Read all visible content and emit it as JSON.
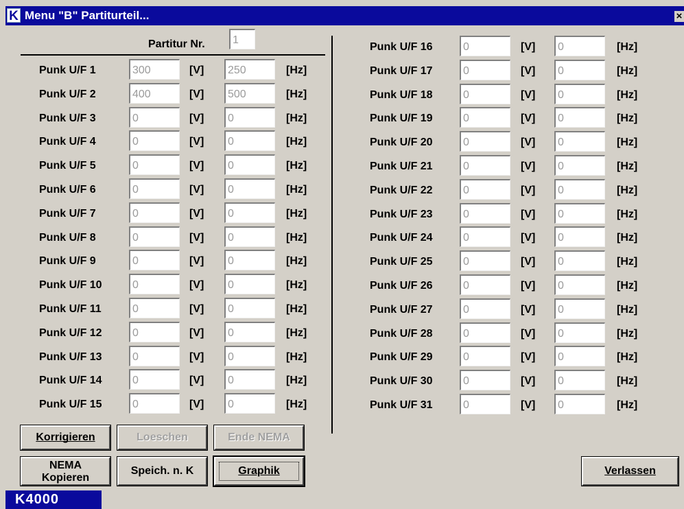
{
  "window": {
    "title": "Menu \"B\" Partiturteil...",
    "icon_letter": "K",
    "close_glyph": "×"
  },
  "partitur": {
    "label": "Partitur Nr.",
    "value": "1"
  },
  "units": {
    "volt": "[V]",
    "hertz": "[Hz]"
  },
  "left_rows": [
    {
      "label": "Punk U/F  1",
      "v": "300",
      "f": "250"
    },
    {
      "label": "Punk U/F  2",
      "v": "400",
      "f": "500"
    },
    {
      "label": "Punk U/F  3",
      "v": "0",
      "f": "0"
    },
    {
      "label": "Punk U/F  4",
      "v": "0",
      "f": "0"
    },
    {
      "label": "Punk U/F  5",
      "v": "0",
      "f": "0"
    },
    {
      "label": "Punk U/F  6",
      "v": "0",
      "f": "0"
    },
    {
      "label": "Punk U/F  7",
      "v": "0",
      "f": "0"
    },
    {
      "label": "Punk U/F  8",
      "v": "0",
      "f": "0"
    },
    {
      "label": "Punk U/F  9",
      "v": "0",
      "f": "0"
    },
    {
      "label": "Punk U/F  10",
      "v": "0",
      "f": "0"
    },
    {
      "label": "Punk U/F  11",
      "v": "0",
      "f": "0"
    },
    {
      "label": "Punk U/F  12",
      "v": "0",
      "f": "0"
    },
    {
      "label": "Punk U/F  13",
      "v": "0",
      "f": "0"
    },
    {
      "label": "Punk U/F  14",
      "v": "0",
      "f": "0"
    },
    {
      "label": "Punk U/F  15",
      "v": "0",
      "f": "0"
    }
  ],
  "right_rows": [
    {
      "label": "Punk U/F  16",
      "v": "0",
      "f": "0"
    },
    {
      "label": "Punk U/F  17",
      "v": "0",
      "f": "0"
    },
    {
      "label": "Punk U/F  18",
      "v": "0",
      "f": "0"
    },
    {
      "label": "Punk U/F  19",
      "v": "0",
      "f": "0"
    },
    {
      "label": "Punk U/F  20",
      "v": "0",
      "f": "0"
    },
    {
      "label": "Punk U/F  21",
      "v": "0",
      "f": "0"
    },
    {
      "label": "Punk U/F  22",
      "v": "0",
      "f": "0"
    },
    {
      "label": "Punk U/F  23",
      "v": "0",
      "f": "0"
    },
    {
      "label": "Punk U/F  24",
      "v": "0",
      "f": "0"
    },
    {
      "label": "Punk U/F  25",
      "v": "0",
      "f": "0"
    },
    {
      "label": "Punk U/F  26",
      "v": "0",
      "f": "0"
    },
    {
      "label": "Punk U/F  27",
      "v": "0",
      "f": "0"
    },
    {
      "label": "Punk U/F  28",
      "v": "0",
      "f": "0"
    },
    {
      "label": "Punk U/F  29",
      "v": "0",
      "f": "0"
    },
    {
      "label": "Punk U/F  30",
      "v": "0",
      "f": "0"
    },
    {
      "label": "Punk U/F  31",
      "v": "0",
      "f": "0"
    }
  ],
  "buttons": {
    "korrigieren": "Korrigieren",
    "loeschen": "Loeschen",
    "ende_nema": "Ende NEMA",
    "nema_line1": "NEMA",
    "nema_line2": "Kopieren",
    "speich": "Speich. n. K",
    "graphik": "Graphik",
    "verlassen": "Verlassen"
  },
  "status": {
    "text": "K4000"
  },
  "colors": {
    "title_bar": "#0a0a9c",
    "dialog_bg": "#d4d0c8",
    "field_text": "#9a9a9a"
  }
}
